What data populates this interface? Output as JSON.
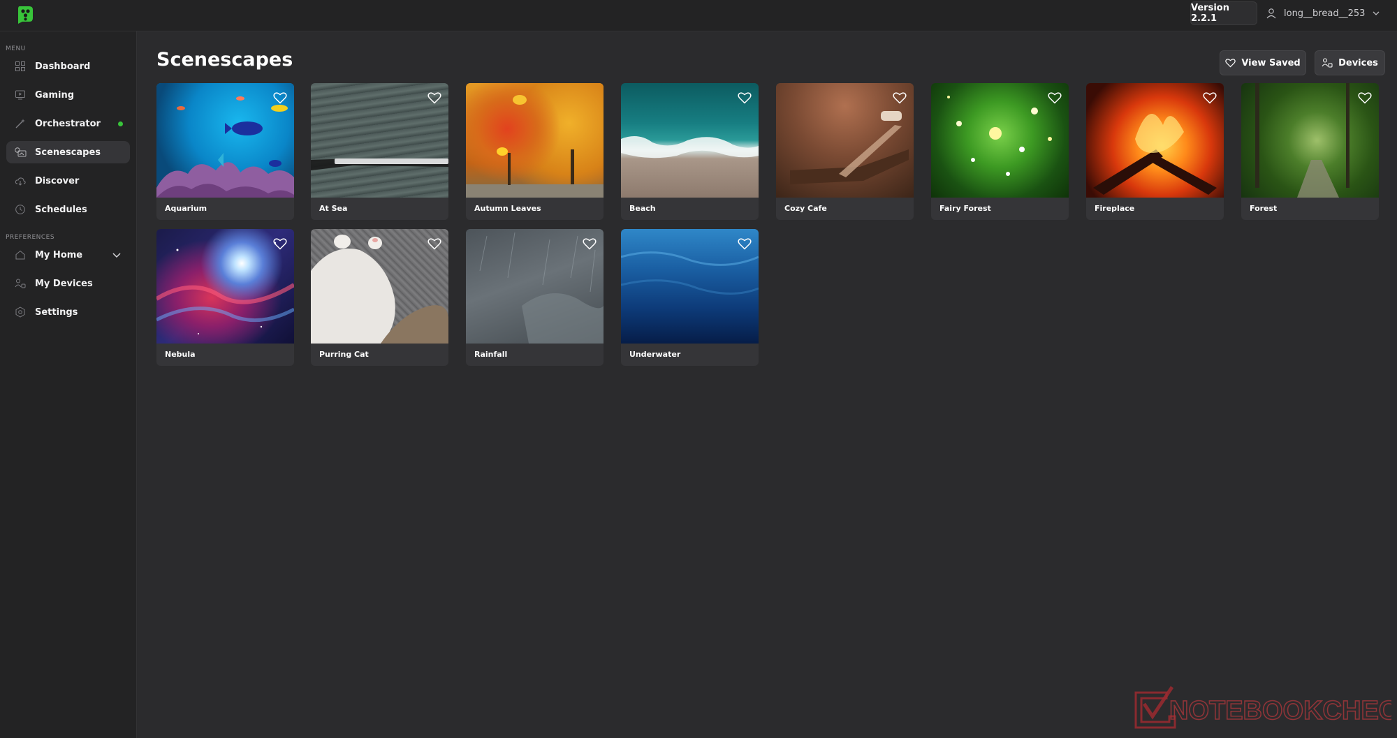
{
  "app": {
    "version_label": "Version 2.2.1",
    "username": "long__bread__253",
    "accent": "#38c43a"
  },
  "sidebar": {
    "menu_label": "MENU",
    "items": [
      {
        "label": "Dashboard",
        "icon": "grid-icon"
      },
      {
        "label": "Gaming",
        "icon": "monitor-play-icon"
      },
      {
        "label": "Orchestrator",
        "icon": "wand-icon",
        "status": "online"
      },
      {
        "label": "Scenescapes",
        "icon": "scenescape-icon",
        "active": true
      },
      {
        "label": "Discover",
        "icon": "cloud-download-icon"
      },
      {
        "label": "Schedules",
        "icon": "clock-icon"
      }
    ],
    "preferences_label": "PREFERENCES",
    "pref_items": [
      {
        "label": "My Home",
        "icon": "home-icon",
        "expandable": true
      },
      {
        "label": "My Devices",
        "icon": "devices-icon"
      },
      {
        "label": "Settings",
        "icon": "gear-icon"
      }
    ]
  },
  "main": {
    "title": "Scenescapes",
    "view_saved_label": "View Saved",
    "devices_label": "Devices",
    "scenes": [
      {
        "name": "Aquarium"
      },
      {
        "name": "At Sea"
      },
      {
        "name": "Autumn Leaves"
      },
      {
        "name": "Beach"
      },
      {
        "name": "Cozy Cafe"
      },
      {
        "name": "Fairy Forest"
      },
      {
        "name": "Fireplace"
      },
      {
        "name": "Forest"
      },
      {
        "name": "Nebula"
      },
      {
        "name": "Purring Cat"
      },
      {
        "name": "Rainfall"
      },
      {
        "name": "Underwater"
      }
    ]
  },
  "watermark": {
    "text": "NOTEBOOKCHECK"
  }
}
